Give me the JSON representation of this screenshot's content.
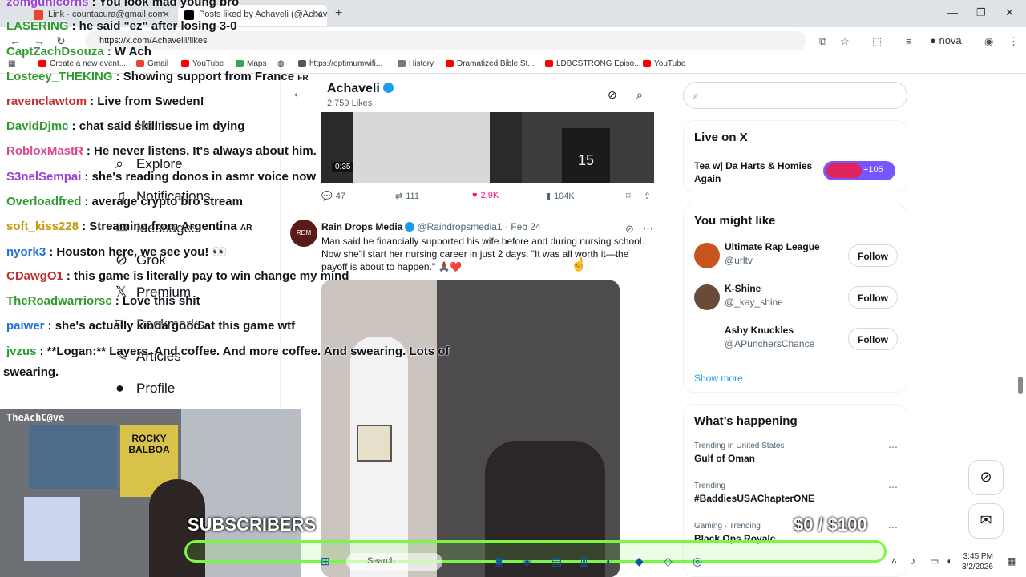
{
  "browser": {
    "tabs": [
      {
        "label": "Link - countacura@gmail.com",
        "active": false
      },
      {
        "label": "Posts liked by Achaveli (@Achav",
        "active": true
      }
    ],
    "url": "https://x.com/Achavelii/likes",
    "profile_name": "nova",
    "bookmarks": [
      "Create a new event...",
      "Gmail",
      "YouTube",
      "Maps",
      "https://optimumwifi...",
      "History",
      "Dramatized Bible St...",
      "LDBCSTRONG Episo...",
      "YouTube"
    ]
  },
  "x": {
    "nav": [
      "Home",
      "Explore",
      "Notifications",
      "Messages",
      "Grok",
      "Premium",
      "Bookmarks",
      "Articles",
      "Profile"
    ],
    "header": {
      "name": "Achaveli",
      "likes": "2,759 Likes"
    },
    "post1": {
      "duration": "0:35",
      "replies": "47",
      "reposts": "111",
      "likes": "2.9K",
      "views": "104K",
      "jersey": "15"
    },
    "post2": {
      "name": "Rain Drops Media",
      "handle": "@Raindropsmedia1",
      "date": "Feb 24",
      "avatar_text": "RDM",
      "text": "Man said he financially supported his wife before and during nursing school. Now she'll start her nursing career in just 2 days. \"It was all worth it—the payoff is about to happen.\" 🙏🏾❤️"
    },
    "search_placeholder": "Search",
    "live": {
      "title": "Live on X",
      "space": "Tea w| Da Harts & Homies Again",
      "count": "+105"
    },
    "suggestions": {
      "title": "You might like",
      "people": [
        {
          "name": "Ultimate Rap League",
          "handle": "@urltv",
          "button": "Follow",
          "color": "#c8541f"
        },
        {
          "name": "K-Shine",
          "handle": "@_kay_shine",
          "button": "Follow",
          "color": "#6b4a3a"
        },
        {
          "name": "Ashy Knuckles",
          "handle": "@APunchersChance",
          "button": "Follow",
          "color": "#ffffff"
        }
      ],
      "show_more": "Show more"
    },
    "happening": {
      "title": "What’s happening",
      "trends": [
        {
          "context": "Trending in United States",
          "title": "Gulf of Oman"
        },
        {
          "context": "Trending",
          "title": "#BaddiesUSAChapterONE"
        },
        {
          "context": "Gaming · Trending",
          "title": "Black Ops Royale"
        }
      ]
    }
  },
  "chat": [
    {
      "user": "zomgunicorns",
      "text": ": You look mad young bro",
      "color": "#9b3fd6"
    },
    {
      "user": "LASERING",
      "text": ": he said \"ez\" after losing 3-0",
      "color": "#2e9b2e"
    },
    {
      "user": "CaptZachDsouza",
      "text": ": W Ach",
      "color": "#2e9b2e"
    },
    {
      "user": "Losteey_THEKING",
      "text": ": Showing support from France",
      "color": "#2e9b2e"
    },
    {
      "user": "ravenclawtom",
      "text": ": Live from Sweden!",
      "color": "#c23030"
    },
    {
      "user": "DavidDjmc",
      "text": ": chat said skill issue im dying",
      "color": "#2e9b2e"
    },
    {
      "user": "RobloxMastR",
      "text": ": He never listens. It's always about him.",
      "color": "#d94a8c"
    },
    {
      "user": "S3nelSempai",
      "text": ": she's reading donos in asmr voice now",
      "color": "#9b3fd6"
    },
    {
      "user": "Overloadfred",
      "text": ": average crypto bro stream",
      "color": "#2e9b2e"
    },
    {
      "user": "soft_kiss228",
      "text": ": Streaming from Argentina",
      "color": "#c29a00"
    },
    {
      "user": "nyork3",
      "text": ": Houston here, we see you! 👀",
      "color": "#1e6fd9"
    },
    {
      "user": "CDawgO1",
      "text": ": this game is literally pay to win change my mind",
      "color": "#c23030"
    },
    {
      "user": "TheRoadwarriorsc",
      "text": ": Love this shit",
      "color": "#2e9b2e"
    },
    {
      "user": "paiwer",
      "text": ": she's actually kinda good at this game wtf",
      "color": "#1e6fd9"
    },
    {
      "user": "jvzus",
      "text": ": **Logan:** Layers. And coffee. And more coffee. And swearing. Lots of",
      "color": "#2e9b2e"
    },
    {
      "user": "",
      "text": "swearing.",
      "color": "#0f1419"
    }
  ],
  "chat_flags": {
    "fr": "FR",
    "ar": "AR"
  },
  "webcam": {
    "title": "TheAchC@ve",
    "poster": "ROCKY BALBOA"
  },
  "overlay": {
    "subscribers": "SUBSCRIBERS",
    "goal": "$0  / $100"
  },
  "taskbar": {
    "search": "Search",
    "time": "3:45 PM",
    "date": "3/2/2026"
  }
}
